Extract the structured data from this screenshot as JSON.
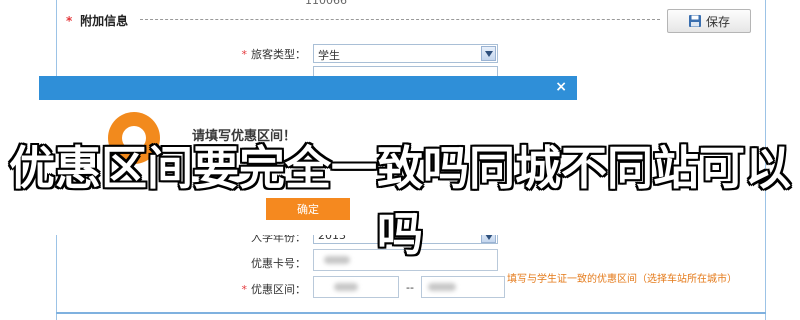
{
  "top_partial_text": "110066",
  "section": {
    "marker": "*",
    "title": "附加信息"
  },
  "save_button": {
    "label": "保存",
    "icon": "save-icon"
  },
  "form": {
    "passenger_type": {
      "marker": "*",
      "label": "旅客类型：",
      "value": "学生"
    },
    "year": {
      "label": "入学年份：",
      "value": "2013"
    },
    "card": {
      "label": "优惠卡号："
    },
    "interval": {
      "marker": "*",
      "label": "优惠区间：",
      "separator": "--"
    },
    "hint": "填写与学生证一致的优惠区间（选择车站所在城市）"
  },
  "dialog": {
    "close": "×",
    "message": "请填写优惠区间！",
    "ok_label": "确定",
    "icon": "info-icon"
  },
  "overlay_title": "优惠区间要完全一致吗同城不同站可以吗",
  "colors": {
    "dialog_bar": "#2f8fd8",
    "ok_button": "#f5891f",
    "hint": "#e47a1a",
    "required": "#e4393c"
  }
}
